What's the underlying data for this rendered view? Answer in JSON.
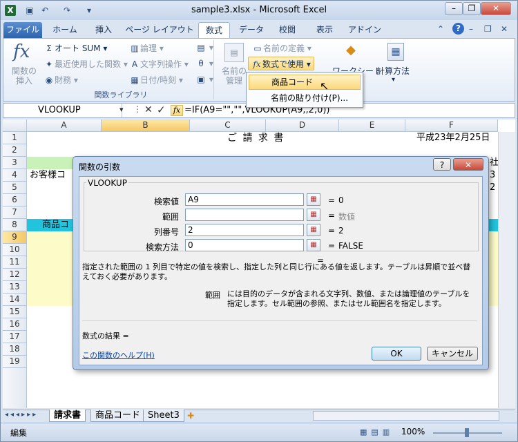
{
  "window": {
    "title": "sample3.xlsx  -  Microsoft Excel",
    "minimize": "–",
    "restore": "❐",
    "close": "✕"
  },
  "ribbon_tabs": [
    "ファイル",
    "ホーム",
    "挿入",
    "ページ レイアウト",
    "数式",
    "データ",
    "校閲",
    "表示",
    "アドイン"
  ],
  "ribbon": {
    "insert_function": "関数の\n挿入",
    "autosum": "オート SUM",
    "recent": "最近使用した関数",
    "financial": "財務",
    "logical": "論理",
    "text": "文字列操作",
    "datetime": "日付/時刻",
    "group_library": "関数ライブラリ",
    "name_manager": "名前の\n管理",
    "define_name": "名前の定義",
    "use_in_formula": "数式で使用",
    "watch_window": "ワークシート",
    "calc_options": "計算方法"
  },
  "dropdown_menu": {
    "items": [
      "商品コード",
      "名前の貼り付け(P)..."
    ]
  },
  "formula_bar": {
    "name_box": "VLOOKUP",
    "formula": "=IF(A9=\"\",\"\",VLOOKUP(A9,,2,0))",
    "fx": "fx"
  },
  "columns": [
    "A",
    "B",
    "C",
    "D",
    "E",
    "F"
  ],
  "rows": [
    "1",
    "2",
    "3",
    "4",
    "5",
    "6",
    "7",
    "8",
    "9",
    "10",
    "11",
    "12",
    "13",
    "14",
    "15",
    "16",
    "17",
    "18",
    "19"
  ],
  "cells": {
    "title": "ご 請 求 書",
    "date": "平成23年2月25日",
    "customer": "お客様コ",
    "header_product": "商品コ",
    "f3": "社",
    "f4a": "3",
    "f4b": "2"
  },
  "dialog": {
    "title": "関数の引数",
    "help_icon": "?",
    "close": "✕",
    "function_name": "VLOOKUP",
    "args": [
      {
        "label": "検索値",
        "value": "A9",
        "result": "0"
      },
      {
        "label": "範囲",
        "value": "",
        "result": "数値"
      },
      {
        "label": "列番号",
        "value": "2",
        "result": "2"
      },
      {
        "label": "検索方法",
        "value": "0",
        "result": "FALSE"
      }
    ],
    "eq": "=",
    "description": "指定された範囲の 1 列目で特定の値を検索し、指定した列と同じ行にある値を返します。テーブルは昇順で並べ替えておく必要があります。",
    "arg_desc_name": "範囲",
    "arg_desc": "には目的のデータが含まれる文字列、数値、または論理値のテーブルを指定します。セル範囲の参照、またはセル範囲名を指定します。",
    "result_label": "数式の結果 =",
    "help_link": "この関数のヘルプ(H)",
    "ok": "OK",
    "cancel": "キャンセル"
  },
  "sheet_tabs": [
    "請求書",
    "商品コード",
    "Sheet3"
  ],
  "status": {
    "mode": "編集",
    "zoom": "100%"
  }
}
